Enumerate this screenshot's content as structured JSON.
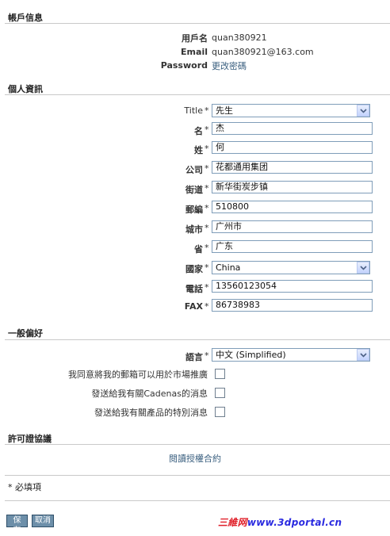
{
  "account": {
    "section_title": "帳戶信息",
    "username_label": "用戶名",
    "username_value": "quan380921",
    "email_label": "Email",
    "email_value": "quan380921@163.com",
    "password_label": "Password",
    "password_link": "更改密碼"
  },
  "personal": {
    "section_title": "個人資訊",
    "title_label": "Title",
    "title_value": "先生",
    "first_name_label": "名",
    "first_name_value": "杰",
    "last_name_label": "姓",
    "last_name_value": "何",
    "company_label": "公司",
    "company_value": "花都通用集团",
    "street_label": "街道",
    "street_value": "新华街炭步镇",
    "postcode_label": "郵編",
    "postcode_value": "510800",
    "city_label": "城市",
    "city_value": "广州市",
    "province_label": "省",
    "province_value": "广东",
    "country_label": "國家",
    "country_value": "China",
    "phone_label": "電話",
    "phone_value": "13560123054",
    "fax_label": "FAX",
    "fax_value": "86738983",
    "required_mark": "*"
  },
  "preferences": {
    "section_title": "一般偏好",
    "language_label": "語言",
    "language_value": "中文 (Simplified)",
    "opt_marketing": "我同意將我的郵箱可以用於市場推廣",
    "opt_cadenas": "發送給我有關Cadenas的消息",
    "opt_products": "發送給我有關產品的特別消息",
    "opt_marketing_checked": false,
    "opt_cadenas_checked": false,
    "opt_products_checked": false
  },
  "license": {
    "section_title": "許可證協議",
    "read_link": "閱讀授權合約"
  },
  "footer": {
    "required_note": "* 必填項",
    "save_label": "保存",
    "cancel_label": "取消"
  },
  "watermark": {
    "part1": "三維网",
    "part2": "www.3dportal.cn"
  }
}
